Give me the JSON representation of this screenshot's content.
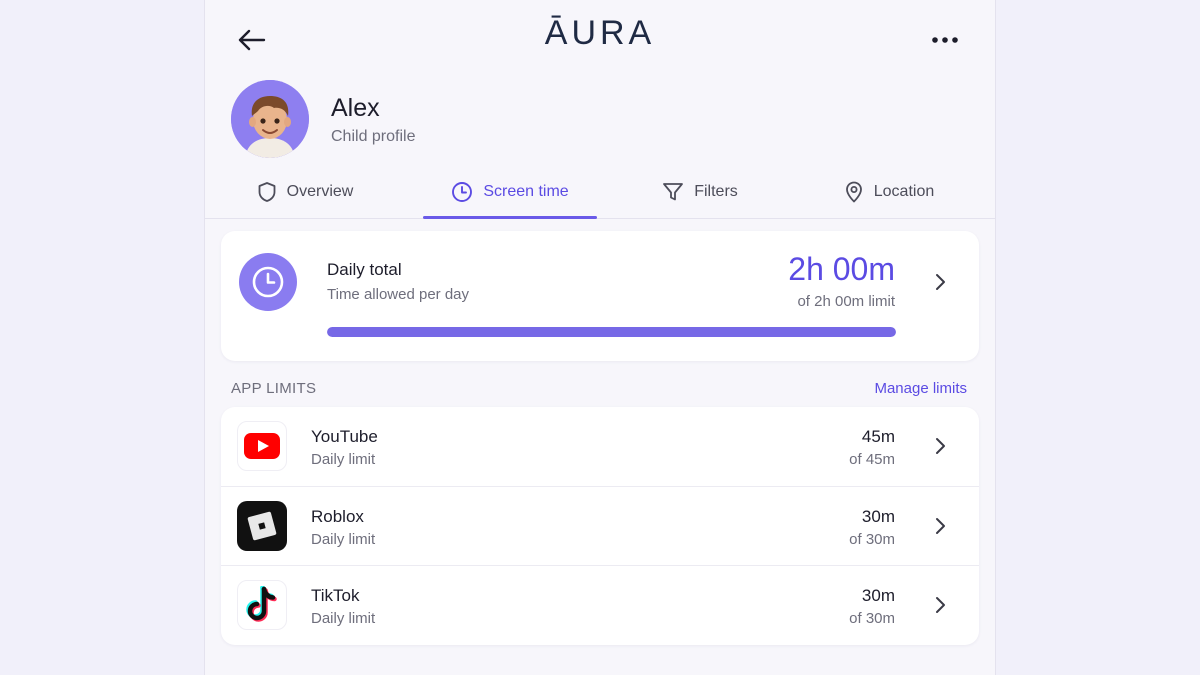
{
  "header": {
    "logo": "ĀURA",
    "back_icon": "arrow-left-icon",
    "more_icon": "more-horizontal-icon"
  },
  "profile": {
    "name": "Alex",
    "subtitle": "Child profile",
    "avatar": "child-avatar"
  },
  "tabs": [
    {
      "label": "Overview",
      "icon": "shield-icon",
      "active": false
    },
    {
      "label": "Screen time",
      "icon": "clock-icon",
      "active": true
    },
    {
      "label": "Filters",
      "icon": "filter-icon",
      "active": false
    },
    {
      "label": "Location",
      "icon": "location-pin-icon",
      "active": false
    }
  ],
  "daily_total": {
    "title": "Daily total",
    "subtitle": "Time allowed per day",
    "value": "2h 00m",
    "limit_text": "of 2h 00m limit",
    "progress_fraction": 1.0
  },
  "app_limits": {
    "section_label": "APP LIMITS",
    "manage_label": "Manage limits",
    "apps": [
      {
        "name": "YouTube",
        "subtitle": "Daily limit",
        "value": "45m",
        "limit_text": "of 45m",
        "icon": "youtube-icon"
      },
      {
        "name": "Roblox",
        "subtitle": "Daily limit",
        "value": "30m",
        "limit_text": "of 30m",
        "icon": "roblox-icon"
      },
      {
        "name": "TikTok",
        "subtitle": "Daily limit",
        "value": "30m",
        "limit_text": "of 30m",
        "icon": "tiktok-icon"
      }
    ]
  },
  "colors": {
    "accent": "#5b4be3",
    "progress": "#7668e6",
    "background": "#f1f0fa",
    "card": "#ffffff"
  }
}
